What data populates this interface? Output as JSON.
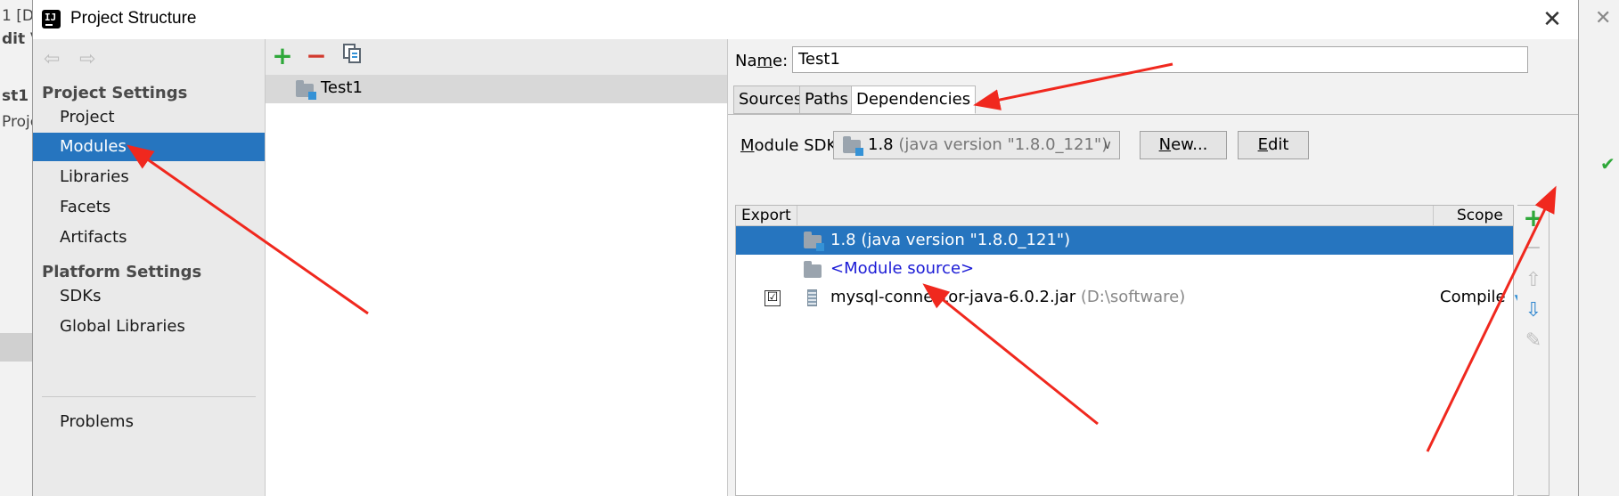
{
  "background": {
    "fragments": [
      "1  [D",
      "dit  V",
      "st1",
      "Proje"
    ]
  },
  "dialog": {
    "title": "Project Structure",
    "close_glyph": "✕"
  },
  "sidebar": {
    "back_glyph": "⇦",
    "forward_glyph": "⇨",
    "project_settings": "Project Settings",
    "platform_settings": "Platform Settings",
    "items": [
      {
        "label": "Project"
      },
      {
        "label": "Modules"
      },
      {
        "label": "Libraries"
      },
      {
        "label": "Facets"
      },
      {
        "label": "Artifacts"
      },
      {
        "label": "SDKs"
      },
      {
        "label": "Global Libraries"
      },
      {
        "label": "Problems"
      }
    ],
    "selected": "Modules"
  },
  "middle": {
    "add_glyph": "+",
    "remove_glyph": "−",
    "module_name": "Test1"
  },
  "right": {
    "name_label_pre": "Na",
    "name_label_u": "m",
    "name_label_post": "e:",
    "name_value": "Test1",
    "tabs": [
      "Sources",
      "Paths",
      "Dependencies"
    ],
    "active_tab": "Dependencies",
    "sdk_label_u": "M",
    "sdk_label_rest": "odule SDK:",
    "sdk_value": "1.8",
    "sdk_detail": "(java version \"1.8.0_121\")",
    "new_u": "N",
    "new_rest": "ew...",
    "edit_u": "E",
    "edit_rest": "dit",
    "table": {
      "col_export": "Export",
      "col_scope": "Scope",
      "rows": [
        {
          "name": "1.8 (java version \"1.8.0_121\")"
        },
        {
          "name": "<Module source>"
        },
        {
          "name": "mysql-connector-java-6.0.2.jar",
          "path": "(D:\\software)",
          "checked": "☑",
          "scope": "Compile"
        }
      ]
    },
    "tools": {
      "add": "+",
      "remove": "−",
      "up": "⇧",
      "down": "⇩",
      "edit": "✎"
    }
  },
  "colors": {
    "selection": "#2675bf",
    "add_green": "#2fa83a",
    "remove_red": "#d23a2e",
    "annotation_red": "#f0281e"
  }
}
